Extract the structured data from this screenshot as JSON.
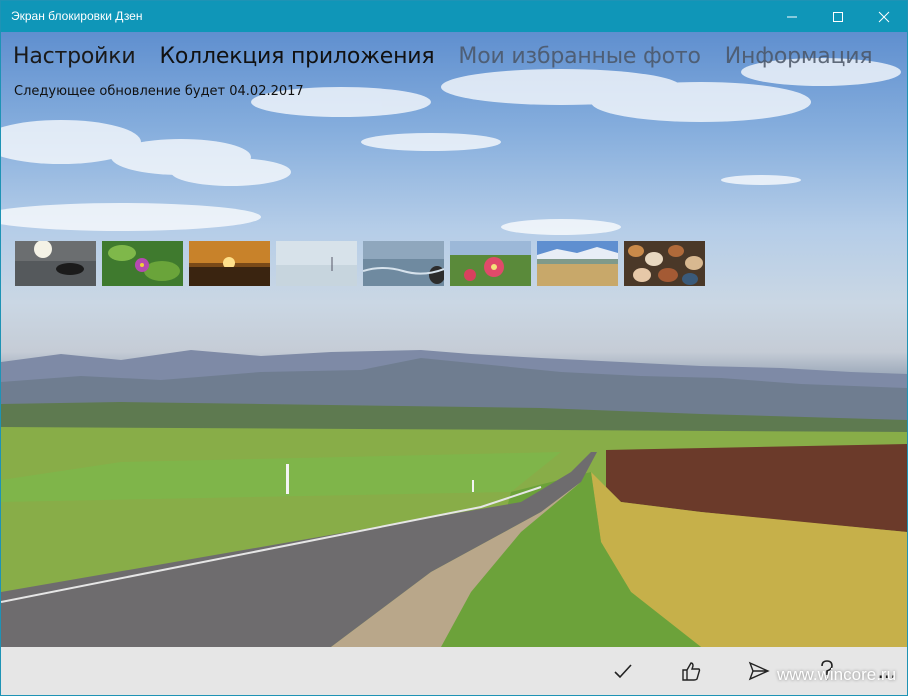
{
  "window": {
    "title": "Экран блокировки Дзен"
  },
  "tabs": [
    {
      "label": "Настройки"
    },
    {
      "label": "Коллекция приложения"
    },
    {
      "label": "Мои избранные фото"
    },
    {
      "label": "Информация"
    }
  ],
  "update_text": "Следующее обновление будет 04.02.2017",
  "thumbnails_count": 8,
  "commands": {
    "more": "..."
  },
  "watermark": "www.wincore.ru",
  "colors": {
    "titlebar": "#0f96b8",
    "command_bar": "#e6e6e6"
  }
}
